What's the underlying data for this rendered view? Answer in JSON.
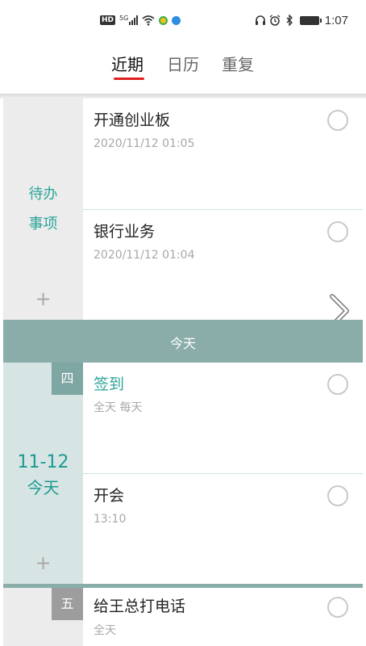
{
  "status_bar": {
    "hd": "HD",
    "network": "5G",
    "time": "1:07",
    "icons": [
      "hd-badge",
      "signal-icon",
      "wifi-icon",
      "app-notification-icon",
      "app-notification-icon",
      "headset-icon",
      "alarm-icon",
      "bluetooth-icon",
      "battery-icon"
    ]
  },
  "tabs": [
    {
      "label": "近期",
      "active": true
    },
    {
      "label": "日历",
      "active": false
    },
    {
      "label": "重复",
      "active": false
    }
  ],
  "pending": {
    "label_line1": "待办",
    "label_line2": "事项",
    "add": "+",
    "tasks": [
      {
        "title": "开通创业板",
        "subtitle": "2020/11/12 01:05"
      },
      {
        "title": "银行业务",
        "subtitle": "2020/11/12 01:04"
      }
    ]
  },
  "today_bar": "今天",
  "today": {
    "weekday": "四",
    "date": "11-12",
    "label": "今天",
    "add": "+",
    "tasks": [
      {
        "title": "签到",
        "subtitle": "全天 每天",
        "title_color": "#2fa59b"
      },
      {
        "title": "开会",
        "subtitle": "13:10"
      }
    ]
  },
  "next_day": {
    "weekday": "五",
    "tasks": [
      {
        "title": "给王总打电话",
        "subtitle": "全天"
      }
    ]
  },
  "colors": {
    "accent_teal": "#2fa59b",
    "today_bar": "#8bada9",
    "tab_underline": "#e02020",
    "pending_bg": "#ececec",
    "today_bg": "#d6e5e3"
  }
}
